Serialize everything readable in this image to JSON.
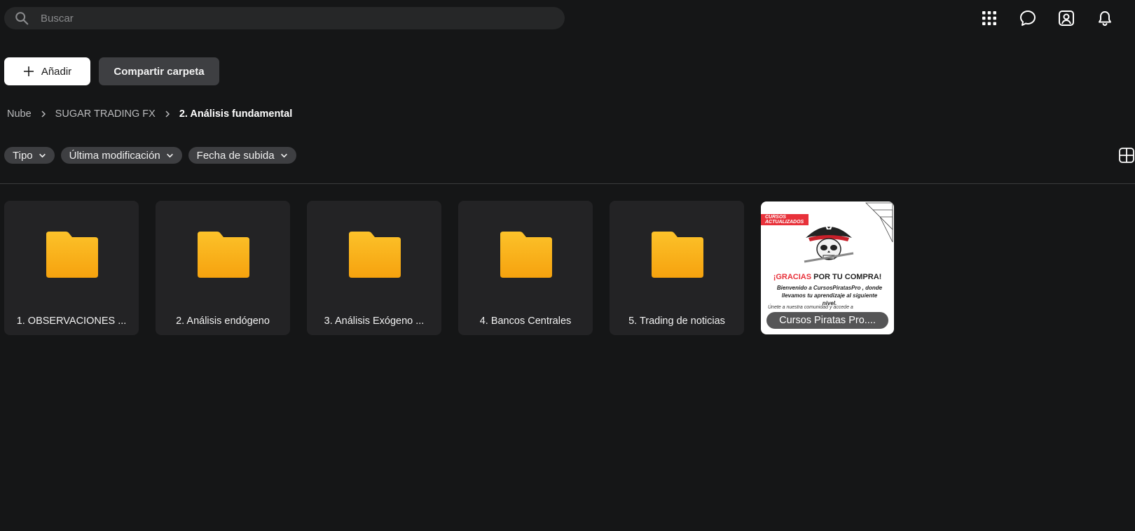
{
  "search": {
    "placeholder": "Buscar"
  },
  "top_icons": [
    "apps-grid-icon",
    "chat-icon",
    "account-icon",
    "bell-icon"
  ],
  "actions": {
    "add_label": "Añadir",
    "share_label": "Compartir carpeta"
  },
  "breadcrumb": {
    "items": [
      "Nube",
      "SUGAR TRADING FX",
      "2. Análisis fundamental"
    ]
  },
  "filters": [
    "Tipo",
    "Última modificación",
    "Fecha de subida"
  ],
  "folders": [
    {
      "name": "1. OBSERVACIONES ..."
    },
    {
      "name": "2. Análisis endógeno"
    },
    {
      "name": "3. Análisis Exógeno ..."
    },
    {
      "name": "4. Bancos Centrales"
    },
    {
      "name": "5. Trading de noticias"
    }
  ],
  "image_file": {
    "name": "Cursos Piratas Pro....",
    "banner": "CURSOS ACTUALIZADOS",
    "thanks_red": "¡GRACIAS",
    "thanks_rest": " POR TU COMPRA!",
    "welcome": "Bienvenido a CursosPiratasPro , donde llevamos tu aprendizaje al siguiente nivel.",
    "join": "Únete a nuestra comunidad y accede a"
  },
  "colors": {
    "background": "#151617",
    "card": "#232325",
    "folder": "#fbb516",
    "accent_red": "#e8313a"
  }
}
